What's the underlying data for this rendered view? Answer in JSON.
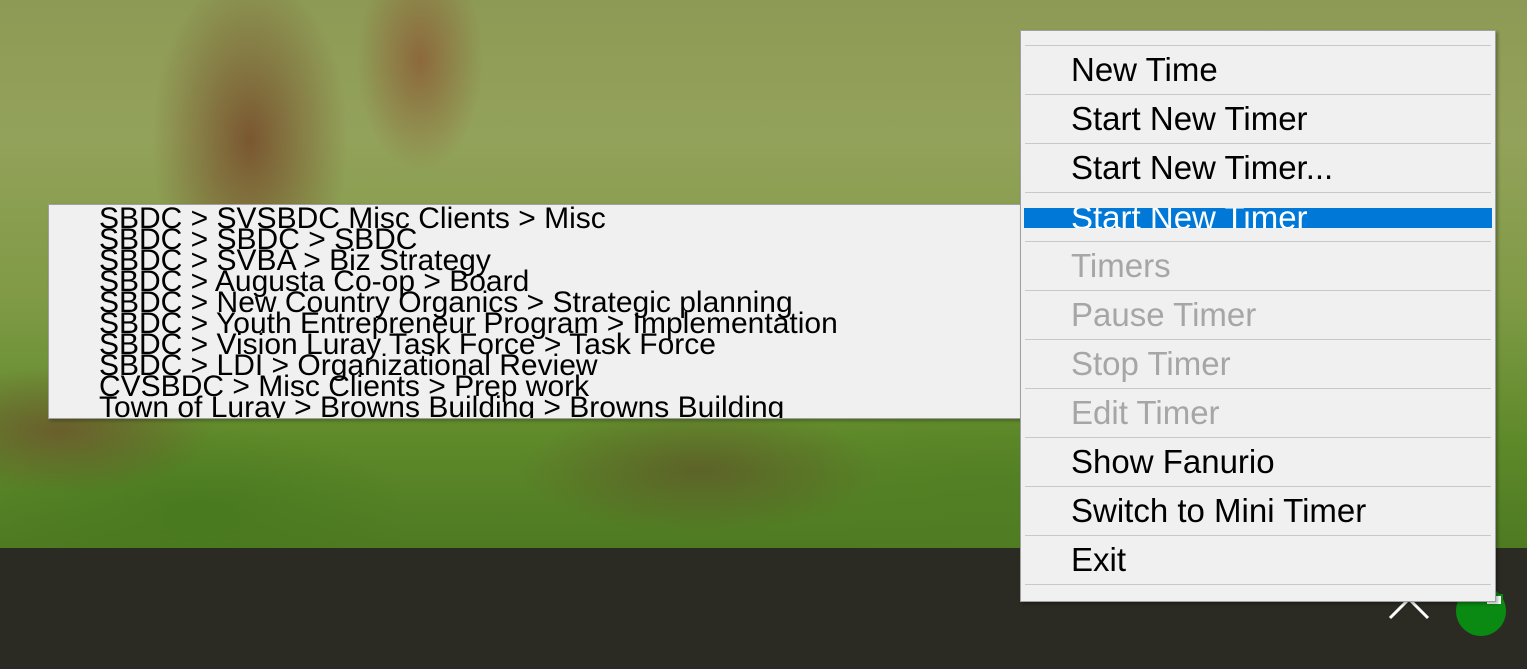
{
  "context_menu": {
    "items": [
      {
        "label": "New Time",
        "state": "normal"
      },
      {
        "label": "Start New Timer",
        "state": "normal"
      },
      {
        "label": "Start New Timer...",
        "state": "normal"
      },
      {
        "label": "Start New Timer",
        "state": "highlighted",
        "has_submenu": true
      },
      {
        "label": "Timers",
        "state": "disabled"
      },
      {
        "label": "Pause Timer",
        "state": "disabled"
      },
      {
        "label": "Stop Timer",
        "state": "disabled"
      },
      {
        "label": "Edit Timer",
        "state": "disabled"
      },
      {
        "label": "Show Fanurio",
        "state": "normal"
      },
      {
        "label": "Switch to Mini Timer",
        "state": "normal"
      },
      {
        "label": "Exit",
        "state": "normal"
      }
    ],
    "highlight_color": "#0078d7",
    "disabled_color": "#a6a6a6"
  },
  "submenu": {
    "items": [
      {
        "label": "SBDC > SVSBDC Misc Clients > Misc"
      },
      {
        "label": "SBDC > SBDC  > SBDC"
      },
      {
        "label": "SBDC > SVBA > Biz Strategy"
      },
      {
        "label": "SBDC > Augusta Co-op > Board"
      },
      {
        "label": "SBDC > New Country Organics > Strategic planning"
      },
      {
        "label": "SBDC > Youth Entrepreneur Program > Implementation"
      },
      {
        "label": "SBDC > Vision Luray Task Force > Task Force"
      },
      {
        "label": "SBDC > LDI > Organizational Review"
      },
      {
        "label": "CVSBDC > Misc Clients > Prep work"
      },
      {
        "label": "Town of Luray > Browns Building > Browns Building"
      }
    ]
  },
  "taskbar": {
    "tray_icons": [
      "chevron-up-icon",
      "fanurio-tray-icon"
    ],
    "fanurio_icon_color": "#0a8a12"
  }
}
